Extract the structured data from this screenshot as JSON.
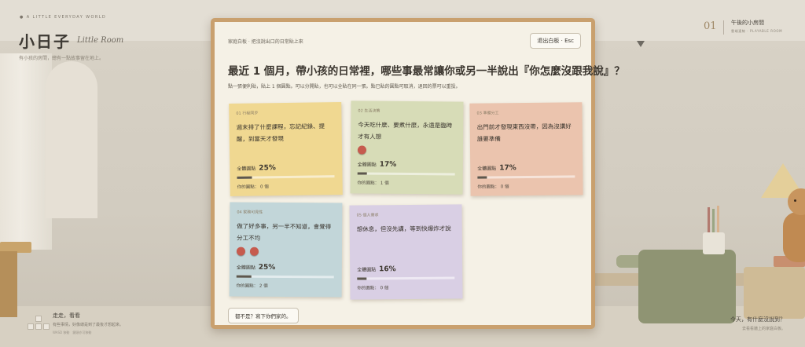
{
  "background": {
    "brand_tag": "● A LITTLE EVERYDAY WORLD",
    "brand_title": "小日子",
    "brand_subtitle": "Little Room",
    "brand_desc": "有小孩的房間，總有一點故事留在地上。",
    "walk_title": "走走，看看",
    "walk_desc": "有些事情，好像總是到了最後才想起來。",
    "walk_hint": "WASD 移動　鍵頭亦可移動",
    "room_number": "01",
    "room_title": "午後的小房間",
    "room_subtitle": "雲端連線 · PLAYABLE ROOM",
    "corner_title": "今天，有什麼沒說到？",
    "corner_sub": "去看看牆上的家庭白板。"
  },
  "board": {
    "breadcrumb": "家庭白板 · 把沒說出口的日常貼上來",
    "exit_label": "退出白板 · Esc",
    "question": "最近 1 個月，帶小孩的日常裡，哪些事最常讓你或另一半說出『你怎麼沒跟我說』？",
    "instructions": "點一張便利貼，貼上 1 個圓點。可以分開貼，也可以全貼在同一張。點已貼的圓點可取消，退回的票可以重投。",
    "total_label": "全體圓點",
    "mine_label": "你的圓點：",
    "mine_unit": "個",
    "write_label": "都不是？寫下你們家的。",
    "notes": [
      {
        "tag": "01 行程同步",
        "text": "週末排了什麼課程，忘記紀錄、提醒，到當天才發現",
        "pct": "25%",
        "share": 0.25,
        "mine": "0",
        "dots": 0,
        "color": "#f0d891"
      },
      {
        "tag": "02 生活決策",
        "text": "今天吃什麼、要煮什麼，永遠是臨時才有人想",
        "pct": "17%",
        "share": 0.17,
        "mine": "1",
        "dots": 1,
        "color": "#d7dcb7"
      },
      {
        "tag": "03 準備分工",
        "text": "出門前才發現東西沒帶，因為沒講好誰要準備",
        "pct": "17%",
        "share": 0.17,
        "mine": "0",
        "dots": 0,
        "color": "#ebc4ae"
      },
      {
        "tag": "04 家務可見性",
        "text": "做了好多事，另一半不知道，會覺得分工不均",
        "pct": "25%",
        "share": 0.25,
        "mine": "2",
        "dots": 2,
        "color": "#c2d6d9"
      },
      {
        "tag": "05 個人需求",
        "text": "想休息，但沒先講，等到快爆炸才說",
        "pct": "16%",
        "share": 0.16,
        "mine": "0",
        "dots": 0,
        "color": "#d9cfe4"
      }
    ]
  }
}
